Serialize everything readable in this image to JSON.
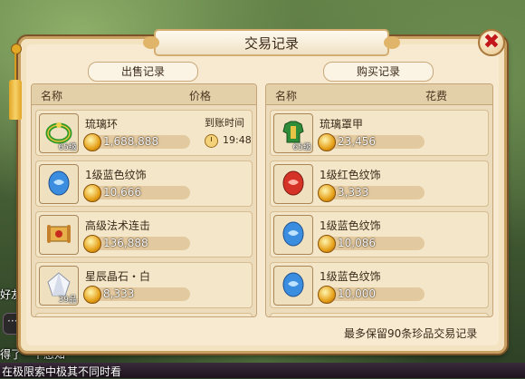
{
  "window": {
    "title": "交易记录",
    "close_symbol": "✖"
  },
  "background": {
    "chat_lines": [
      "好友",
      "得了一个感知",
      "在极限索中极其不同时看"
    ]
  },
  "sell_panel": {
    "tab_label": "出售记录",
    "header_name": "名称",
    "header_price": "价格",
    "items": [
      {
        "name": "琉璃环",
        "price": "1,688,888",
        "level": "65级",
        "icon": "green-ring-icon",
        "arrival_label": "到账时间",
        "arrival_time": "19:48"
      },
      {
        "name": "1级蓝色纹饰",
        "price": "10,666",
        "level": "",
        "icon": "blue-gem-icon"
      },
      {
        "name": "高级法术连击",
        "price": "136,888",
        "level": "",
        "icon": "scroll-icon"
      },
      {
        "name": "星辰晶石・白",
        "price": "8,333",
        "level": "39品",
        "icon": "white-crystal-icon"
      }
    ]
  },
  "buy_panel": {
    "tab_label": "购买记录",
    "header_name": "名称",
    "header_cost": "花费",
    "items": [
      {
        "name": "琉璃罩甲",
        "price": "23,456",
        "level": "65级",
        "icon": "green-armor-icon"
      },
      {
        "name": "1级红色纹饰",
        "price": "3,333",
        "level": "",
        "icon": "red-gem-icon"
      },
      {
        "name": "1级蓝色纹饰",
        "price": "10,086",
        "level": "",
        "icon": "blue-gem-icon"
      },
      {
        "name": "1级蓝色纹饰",
        "price": "10,000",
        "level": "",
        "icon": "blue-gem-icon"
      }
    ]
  },
  "footer_note": "最多保留90条珍品交易记录",
  "colors": {
    "panel": "#f3e3c0",
    "border": "#c9a062",
    "close": "#c2171b",
    "coin": "#e6a11a"
  }
}
